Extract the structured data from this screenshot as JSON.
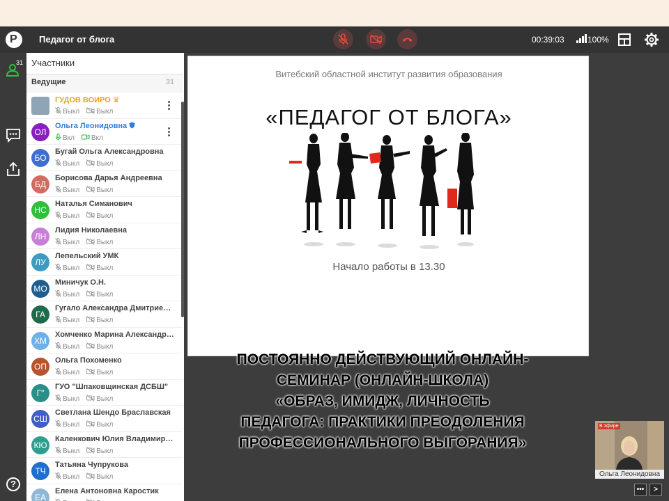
{
  "header": {
    "logo": "P",
    "title": "Педагог от блога",
    "timer": "00:39:03",
    "signal_level": "100%"
  },
  "rail": {
    "participants_count": "31",
    "help": "?"
  },
  "panel": {
    "title": "Участники",
    "section": "Ведущие",
    "section_count": "31",
    "participants": [
      {
        "initials": "",
        "name": "ГУДОВ ВОИРО",
        "mic": "Выкл",
        "cam": "Выкл",
        "color": "#9aa3ad",
        "name_color": "#e8a319",
        "host": true
      },
      {
        "initials": "ОЛ",
        "name": "Ольга Леонидовна",
        "mic": "Вкл",
        "cam": "Вкл",
        "color": "#8a1fbf",
        "name_color": "#2f7fd6",
        "host": true
      },
      {
        "initials": "БО",
        "name": "Бугай Ольга Александровна",
        "mic": "Выкл",
        "cam": "Выкл",
        "color": "#3d6fd1"
      },
      {
        "initials": "БД",
        "name": "Борисова Дарья Андреевна",
        "mic": "Выкл",
        "cam": "Выкл",
        "color": "#d46a62"
      },
      {
        "initials": "НС",
        "name": "Наталья Симанович",
        "mic": "Выкл",
        "cam": "Выкл",
        "color": "#2fbf3a"
      },
      {
        "initials": "ЛН",
        "name": "Лидия Николаевна",
        "mic": "Выкл",
        "cam": "Выкл",
        "color": "#c87fd6"
      },
      {
        "initials": "ЛУ",
        "name": "Лепельский УМК",
        "mic": "Выкл",
        "cam": "Выкл",
        "color": "#3d9bc2"
      },
      {
        "initials": "МО",
        "name": "Миничук О.Н.",
        "mic": "Выкл",
        "cam": "Выкл",
        "color": "#1f5d8f"
      },
      {
        "initials": "ГА",
        "name": "Гугало Александра Дмитриевна",
        "mic": "Выкл",
        "cam": "Выкл",
        "color": "#1d6b4a"
      },
      {
        "initials": "ХМ",
        "name": "Хомченко Марина Александровна",
        "mic": "Выкл",
        "cam": "Выкл",
        "color": "#6fb0e8"
      },
      {
        "initials": "ОП",
        "name": "Ольга Похоменко",
        "mic": "Выкл",
        "cam": "Выкл",
        "color": "#b8532c"
      },
      {
        "initials": "Г\"",
        "name": "ГУО \"Шпаковщинская ДСБШ\"",
        "mic": "Выкл",
        "cam": "Выкл",
        "color": "#2a8f86"
      },
      {
        "initials": "СШ",
        "name": "Светлана Шендо Браславская",
        "mic": "Выкл",
        "cam": "Выкл",
        "color": "#3f5ec9"
      },
      {
        "initials": "КЮ",
        "name": "Каленкович Юлия Владимировна",
        "mic": "Выкл",
        "cam": "Выкл",
        "color": "#2f9e8f"
      },
      {
        "initials": "ТЧ",
        "name": "Татьяна Чупрукова",
        "mic": "Выкл",
        "cam": "Выкл",
        "color": "#1f6fd1"
      },
      {
        "initials": "ЕА",
        "name": "Елена Антоновна Каростик",
        "mic": "Выкл",
        "cam": "Выкл",
        "color": "#8fb8d6"
      }
    ]
  },
  "slide": {
    "institution": "Витебский областной институт развития образования",
    "title": "«ПЕДАГОГ ОТ БЛОГА»",
    "start_time": "Начало работы в 13.30"
  },
  "caption": [
    "ПОСТОЯННО ДЕЙСТВУЮЩИЙ ОНЛАЙН-",
    "СЕМИНАР (ОНЛАЙН-ШКОЛА)",
    "«ОБРАЗ, ИМИДЖ, ЛИЧНОСТЬ",
    "ПЕДАГОГА: ПРАКТИКИ ПРЕОДОЛЕНИЯ",
    "ПРОФЕССИОНАЛЬНОГО ВЫГОРАНИЯ»"
  ],
  "video": {
    "live_badge": "В эфире",
    "name": "Ольга Леонидовна"
  },
  "colors": {
    "header_bg": "#333333",
    "host_gold": "#e8a319",
    "moderator_blue": "#2f7fd6",
    "end_call_red": "#e04a3a",
    "mic_on_green": "#27b43a"
  }
}
